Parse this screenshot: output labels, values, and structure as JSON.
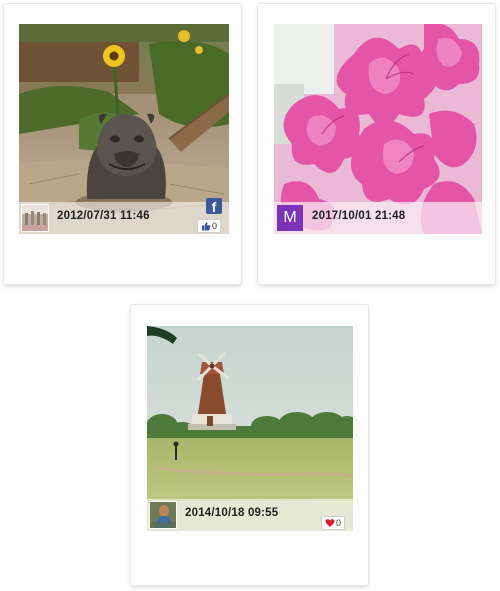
{
  "cards": [
    {
      "date": "2012/07/31 11:46",
      "source_icon": "facebook-icon",
      "source_letter": "f",
      "likes": "0",
      "like_icon": "thumbs-up-icon"
    },
    {
      "date": "2017/10/01 21:48",
      "avatar_letter": "M",
      "avatar_color": "#7b33b8"
    },
    {
      "date": "2014/10/18 09:55",
      "likes": "0",
      "like_icon": "heart-icon",
      "like_color": "#d0202f"
    }
  ],
  "colors": {
    "facebook_blue": "#3b5998",
    "card_background": "#fcfcfc"
  }
}
